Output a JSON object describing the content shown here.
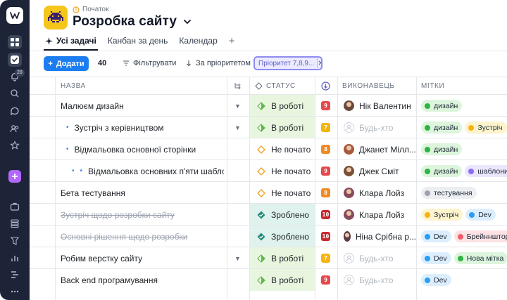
{
  "app": {
    "crumb": "Початок",
    "title": "Розробка сайту"
  },
  "tabs": [
    {
      "label": "Усі задачі"
    },
    {
      "label": "Канбан за день"
    },
    {
      "label": "Календар"
    }
  ],
  "toolbar": {
    "add_label": "Додати",
    "count": "40",
    "filter_label": "Фільтрувати",
    "sort_label": "За пріоритетом",
    "active_filter": "Пріоритет 7,8,9..."
  },
  "notifications_badge": "28",
  "columns": {
    "name": "НАЗВА",
    "status": "СТАТУС",
    "assignee": "ВИКОНАВЕЦЬ",
    "tags": "МІТКИ"
  },
  "colors": {
    "accent": "#1b7df0",
    "priority_red": "#e5484d",
    "priority_orange": "#f08a24",
    "priority_yellow": "#f5b40f",
    "priority_dark_red": "#c62a2f"
  },
  "rows": [
    {
      "name": "Малюєм дизайн",
      "indent": 0,
      "strike": false,
      "expand": true,
      "status": "В роботі",
      "status_kind": "progress",
      "priority": "9",
      "prio_color": "#e5484d",
      "assignee": "Нік Валентин",
      "avatar_color": "#6b4a3a",
      "tags": [
        {
          "label": "дизайн",
          "dot": "#2fb344",
          "bg": "#dcf5dc"
        }
      ]
    },
    {
      "name": "Зустріч з керівництвом",
      "indent": 1,
      "strike": false,
      "expand": true,
      "status": "В роботі",
      "status_kind": "progress",
      "priority": "7",
      "prio_color": "#f5b40f",
      "assignee": "Будь-хто",
      "avatar_color": "",
      "tags": [
        {
          "label": "дизайн",
          "dot": "#2fb344",
          "bg": "#dcf5dc"
        },
        {
          "label": "Зустріч",
          "dot": "#f5b40f",
          "bg": "#fdf3cc"
        }
      ]
    },
    {
      "name": "Відмальовка основної сторінки",
      "indent": 1,
      "strike": false,
      "expand": false,
      "status": "Не почато",
      "status_kind": "todo",
      "priority": "8",
      "prio_color": "#f08a24",
      "assignee": "Джанет Мілл...",
      "avatar_color": "#a85a3c",
      "tags": [
        {
          "label": "дизайн",
          "dot": "#2fb344",
          "bg": "#dcf5dc"
        }
      ]
    },
    {
      "name": "Відмальовка основних п'яти шаблонів",
      "indent": 2,
      "strike": false,
      "expand": false,
      "status": "Не почато",
      "status_kind": "todo",
      "priority": "9",
      "prio_color": "#e5484d",
      "assignee": "Джек Сміт",
      "avatar_color": "#7a4f36",
      "tags": [
        {
          "label": "дизайн",
          "dot": "#2fb344",
          "bg": "#dcf5dc"
        },
        {
          "label": "шаблони",
          "dot": "#8b6cf6",
          "bg": "#ece6fd"
        }
      ]
    },
    {
      "name": "Бета тестування",
      "indent": 0,
      "strike": false,
      "expand": false,
      "status": "Не почато",
      "status_kind": "todo",
      "priority": "8",
      "prio_color": "#f08a24",
      "assignee": "Клара Лойз",
      "avatar_color": "#8a4a5a",
      "tags": [
        {
          "label": "тестування",
          "dot": "#9ca3af",
          "bg": "#eceef1"
        }
      ]
    },
    {
      "name": "Зустріч щодо розробки сайту",
      "indent": 0,
      "strike": true,
      "expand": false,
      "status": "Зроблено",
      "status_kind": "done",
      "priority": "10",
      "prio_color": "#c62a2f",
      "assignee": "Клара Лойз",
      "avatar_color": "#8a4a5a",
      "tags": [
        {
          "label": "Зустріч",
          "dot": "#f5b40f",
          "bg": "#fdf3cc"
        },
        {
          "label": "Dev",
          "dot": "#2a9df4",
          "bg": "#dceefd"
        }
      ]
    },
    {
      "name": "Основні рішення щодо розробки",
      "indent": 0,
      "strike": true,
      "expand": false,
      "status": "Зроблено",
      "status_kind": "done",
      "priority": "10",
      "prio_color": "#c62a2f",
      "assignee": "Ніна Срібна р...",
      "avatar_color": "#5a3b46",
      "tags": [
        {
          "label": "Dev",
          "dot": "#2a9df4",
          "bg": "#dceefd"
        },
        {
          "label": "Брейнншторм",
          "dot": "#f25f6b",
          "bg": "#fde2e4"
        }
      ]
    },
    {
      "name": "Робим верстку сайту",
      "indent": 0,
      "strike": false,
      "expand": true,
      "status": "В роботі",
      "status_kind": "progress",
      "priority": "7",
      "prio_color": "#f5b40f",
      "assignee": "Будь-хто",
      "avatar_color": "",
      "tags": [
        {
          "label": "Dev",
          "dot": "#2a9df4",
          "bg": "#dceefd"
        },
        {
          "label": "Нова мітка",
          "dot": "#2fb344",
          "bg": "#dcf5dc"
        }
      ]
    },
    {
      "name": "Back end програмування",
      "indent": 0,
      "strike": false,
      "expand": false,
      "status": "В роботі",
      "status_kind": "progress",
      "priority": "9",
      "prio_color": "#e5484d",
      "assignee": "Будь-хто",
      "avatar_color": "",
      "tags": [
        {
          "label": "Dev",
          "dot": "#2a9df4",
          "bg": "#dceefd"
        }
      ]
    }
  ]
}
